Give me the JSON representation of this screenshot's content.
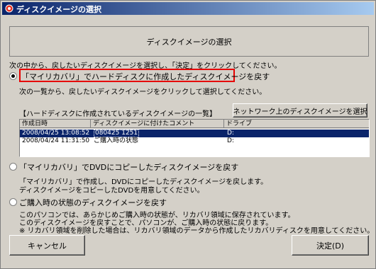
{
  "window": {
    "title": "ディスクイメージの選択"
  },
  "header": {
    "label": "ディスクイメージの選択"
  },
  "instruction": "次の中から、戻したいディスクイメージを選択し、「決定」をクリックしてください。",
  "option1": {
    "label": "「マイリカバリ」でハードディスクに作成したディスクイメージを戻す",
    "sub": "次の一覧から、戻したいディスクイメージをクリックして選択してください。",
    "list_title": "【ハードディスクに作成されているディスクイメージの一覧】",
    "network_button": "ネットワーク上のディスクイメージを選択",
    "columns": [
      "作成日時",
      "ディスクイメージに付けたコメント",
      "ドライブ"
    ],
    "rows": [
      {
        "date": "2008/04/25 13:08:52",
        "comment": "080425 1251",
        "drive": "D:"
      },
      {
        "date": "2008/04/24 11:31:50",
        "comment": "ご購入時の状態",
        "drive": "D:"
      }
    ]
  },
  "option2": {
    "label": "「マイリカバリ」でDVDにコピーしたディスクイメージを戻す",
    "desc1": "「マイリカバリ」で作成し、DVDにコピーしたディスクイメージを戻します。",
    "desc2": "ディスクイメージをコピーしたDVDを用意してください。"
  },
  "option3": {
    "label": "ご購入時の状態のディスクイメージを戻す",
    "desc1": "このパソコンでは、あらかじめご購入時の状態が、リカバリ領域に保存されています。",
    "desc2": "このディスクイメージを戻すことで、パソコンが、ご購入時の状態に戻ります。",
    "desc3": "※ リカバリ領域を削除した場合は、リカバリ領域のデータから作成したリカバリディスクを用意してください。"
  },
  "buttons": {
    "cancel": "キャンセル",
    "ok": "決定(D)"
  }
}
